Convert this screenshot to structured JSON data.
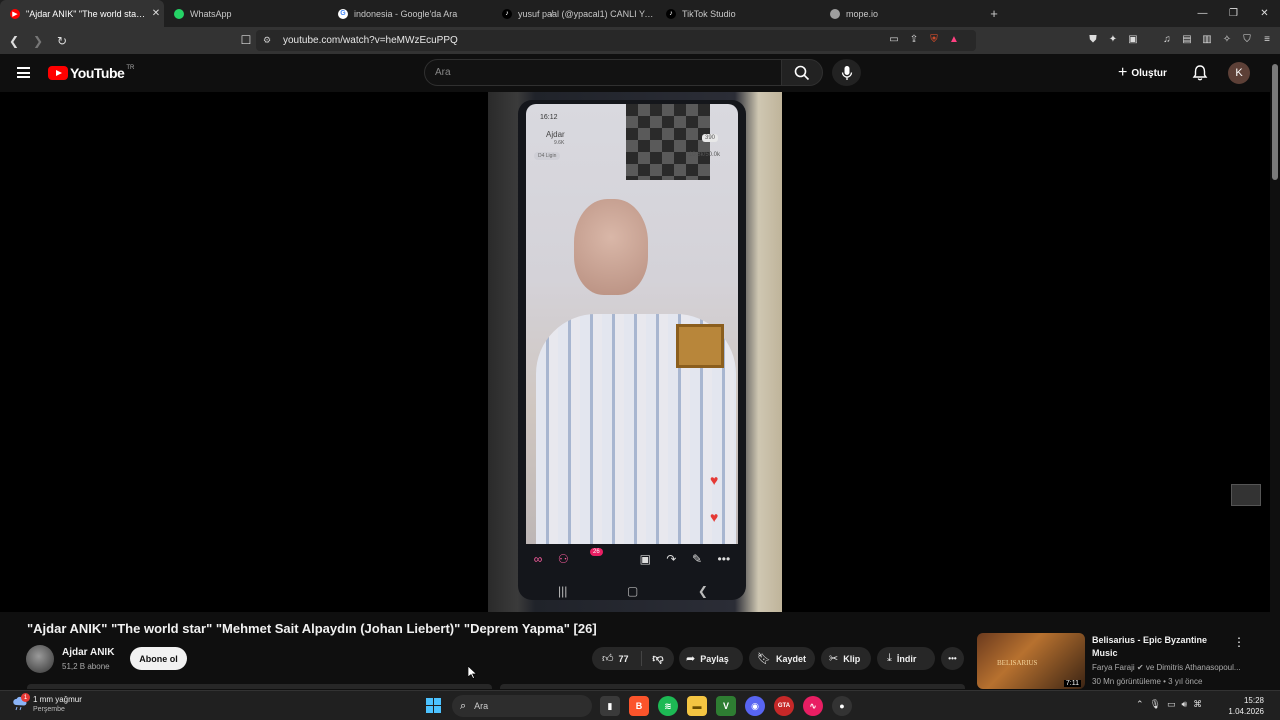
{
  "browser": {
    "tabs": [
      {
        "title": "\"Ajdar ANIK\" \"The world star\" \"M",
        "favicon_color": "#ff0000",
        "active": true
      },
      {
        "title": "WhatsApp",
        "favicon_color": "#25d366",
        "active": false
      },
      {
        "title": "indonesia - Google'da Ara",
        "favicon_color": "#ffffff",
        "active": false
      },
      {
        "title": "yusuf pa̸al (@ypacal1) CANLI Yayın",
        "favicon_color": "#000000",
        "active": false
      },
      {
        "title": "TikTok Studio",
        "favicon_color": "#000000",
        "active": false
      },
      {
        "title": "mope.io",
        "favicon_color": "#9e9e9e",
        "active": false
      }
    ],
    "new_tab": "+",
    "url": "youtube.com/watch?v=heMWzEcuPPQ"
  },
  "youtube": {
    "logo_text": "YouTube",
    "country_code": "TR",
    "search_placeholder": "Ara",
    "create_label": "Oluştur",
    "avatar_letter": "K"
  },
  "video_overlay": {
    "time": "16:12",
    "username": "Ajdar",
    "sub": "9.6K",
    "viewers": "390",
    "league": "D4 Ligin",
    "score": "10.8k/50.0k",
    "badge": "26"
  },
  "video": {
    "title": "\"Ajdar ANIK\" \"The world star\" \"Mehmet Sait Alpaydın (Johan Liebert)\" \"Deprem Yapma\" [26]",
    "channel_name": "Ajdar ANIK",
    "subscribers": "51,2 B abone",
    "subscribe_label": "Abone ol",
    "like_count": "77",
    "share_label": "Paylaş",
    "save_label": "Kaydet",
    "clip_label": "Klip",
    "download_label": "İndir",
    "more_label": "•••"
  },
  "suggestion": {
    "thumb_label": "BELISARIUS",
    "duration": "7:11",
    "title": "Belisarius - Epic Byzantine Music",
    "channel": "Farya Faraji ✔ ve Dimitris Athanasopoul...",
    "meta": "30 Mn görüntüleme • 3 yıl önce"
  },
  "taskbar": {
    "weather": "1 mm yağmur",
    "weather_day": "Perşembe",
    "weather_badge": "1",
    "search_placeholder": "Ara",
    "time": "15:28",
    "date": "1.04.2026"
  }
}
